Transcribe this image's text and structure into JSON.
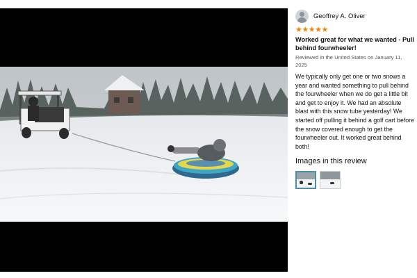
{
  "review": {
    "reviewer_name": "Geoffrey A. Oliver",
    "rating_stars": "★★★★★",
    "rating": 5,
    "title": "Worked great for what we wanted - Pull behind fourwheeler!",
    "meta": "Reviewed in the United States on January 11, 2025",
    "body": "We typically only get one or two snows a year and wanted something to pull behind the fourwheeler when we do get a little bit and get to enjoy it. We had an absolute blast with this snow tube yesterday! We started off pulling it behind a golf cart before the snow covered enough to get the fourwheeler out. It worked great behind both!",
    "images_title": "Images in this review",
    "thumbnails": [
      "selected",
      "normal"
    ]
  },
  "colors": {
    "star": "#f08804",
    "viewer_background": "#000000",
    "selected_thumb_border": "#4a90a4"
  },
  "icons": {
    "avatar": "default-user-avatar-icon"
  }
}
